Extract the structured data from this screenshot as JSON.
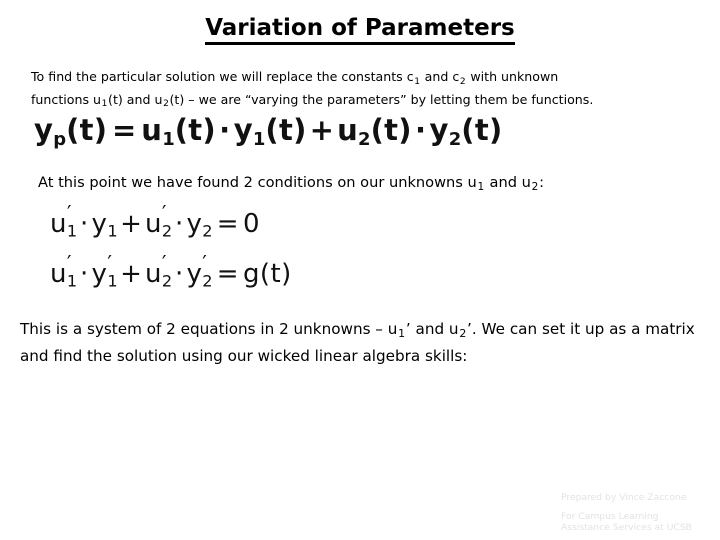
{
  "slide": {
    "title": "Variation of Parameters",
    "background_color": "#ffffff",
    "text_color": "#000000",
    "footer_color": "#e3e3e3"
  },
  "intro_paragraph": {
    "line1_part1": "To find the particular solution we will replace the constants c",
    "line1_sub1": "1",
    "line1_part2": " and c",
    "line1_sub2": "2",
    "line1_part3": " with unknown",
    "line2_part1": "functions u",
    "line2_sub1": "1",
    "line2_part2": "(t) and u",
    "line2_sub2": "2",
    "line2_part3": "(t) – we are “varying the parameters” by letting them be functions."
  },
  "equation_particular": {
    "lhs_base": "y",
    "lhs_sub": "p",
    "lhs_arg": "(t)",
    "equals": "=",
    "term1_base": "u",
    "term1_sub": "1",
    "term1_arg": "(t)",
    "dot1": "·",
    "term2_base": "y",
    "term2_sub": "1",
    "term2_arg": "(t)",
    "plus": "+",
    "term3_base": "u",
    "term3_sub": "2",
    "term3_arg": "(t)",
    "dot2": "·",
    "term4_base": "y",
    "term4_sub": "2",
    "term4_arg": "(t)",
    "plain": "yp(t) = u1(t) · y1(t) + u2(t) · y2(t)"
  },
  "conditions_paragraph": {
    "part1": "At this point we have found 2 conditions on our unknowns u",
    "sub1": "1",
    "part2": " and u",
    "sub2": "2",
    "part3": ":"
  },
  "equation_condition_1": {
    "t1_base": "u",
    "t1_prime": "′",
    "t1_sub": "1",
    "dot1": "·",
    "t2_base": "y",
    "t2_sub": "1",
    "plus": "+",
    "t3_base": "u",
    "t3_prime": "′",
    "t3_sub": "2",
    "dot2": "·",
    "t4_base": "y",
    "t4_sub": "2",
    "equals": "=",
    "rhs": "0",
    "plain": "u′1 · y1 + u′2 · y2 = 0"
  },
  "equation_condition_2": {
    "t1_base": "u",
    "t1_prime": "′",
    "t1_sub": "1",
    "dot1": "·",
    "t2_base": "y",
    "t2_prime": "′",
    "t2_sub": "1",
    "plus": "+",
    "t3_base": "u",
    "t3_prime": "′",
    "t3_sub": "2",
    "dot2": "·",
    "t4_base": "y",
    "t4_prime": "′",
    "t4_sub": "2",
    "equals": "=",
    "rhs": "g(t)",
    "plain": "u′1 · y′1 + u′2 · y′2 = g(t)"
  },
  "system_paragraph": {
    "part1": "This is a system of 2 equations in 2 unknowns – u",
    "sub1": "1",
    "prime1": "’",
    "part2": " and u",
    "sub2": "2",
    "prime2": "’",
    "part3": ". We can set it up as a matrix and find the solution using our wicked linear algebra skills:"
  },
  "footer": {
    "line1": "Prepared by Vince Zaccone",
    "line2": "For Campus Learning",
    "line3": "Assistance Services at UCSB"
  }
}
